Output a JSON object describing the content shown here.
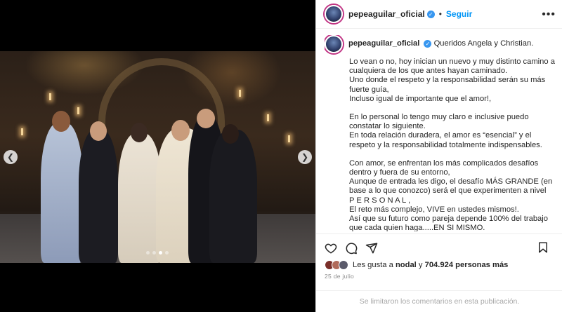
{
  "post": {
    "username": "pepeaguilar_oficial",
    "follow_label": "Seguir",
    "more_label": "•••",
    "caption_greeting": "Queridos Angela y Christian.",
    "caption_paragraphs": [
      "Lo vean o no, hoy inician un nuevo y muy distinto camino a cualquiera de los que antes hayan caminado.\nUno donde el respeto y la responsabilidad serán su más fuerte guía,\nIncluso igual de importante que el amor!,",
      "En lo personal lo tengo muy claro e inclusive puedo constatar lo siguiente.\nEn toda relación duradera, el amor es “esencial” y el respeto y la responsabilidad totalmente indispensables.",
      "Con amor, se enfrentan los más complicados desafíos dentro y fuera de su entorno,\nAunque de entrada les digo, el desafío MÁS GRANDE (en base a lo que conozco) será el que experimenten a nivel\nP E R S O N A L ,\nEl reto más complejo, VIVE en ustedes mismos!.\nAsí que su futuro como pareja depende 100% del trabajo que cada quien haga.....EN SI MISMO."
    ],
    "likes_prefix": "Les gusta a ",
    "likes_user": "nodal",
    "likes_mid": " y ",
    "likes_count": "704.924 personas más",
    "date": "25 de julio",
    "comments_disabled": "Se limitaron los comentarios en esta publicación."
  },
  "carousel": {
    "prev_icon": "chevron-left-icon",
    "next_icon": "chevron-right-icon",
    "slide_count": 4,
    "active_slide": 3
  },
  "icons": {
    "like": "heart-icon",
    "comment": "comment-icon",
    "share": "share-icon",
    "save": "bookmark-icon",
    "verified": "verified-icon"
  },
  "colors": {
    "accent": "#0095f6",
    "verified": "#3897f0",
    "muted": "#8e8e8e"
  }
}
